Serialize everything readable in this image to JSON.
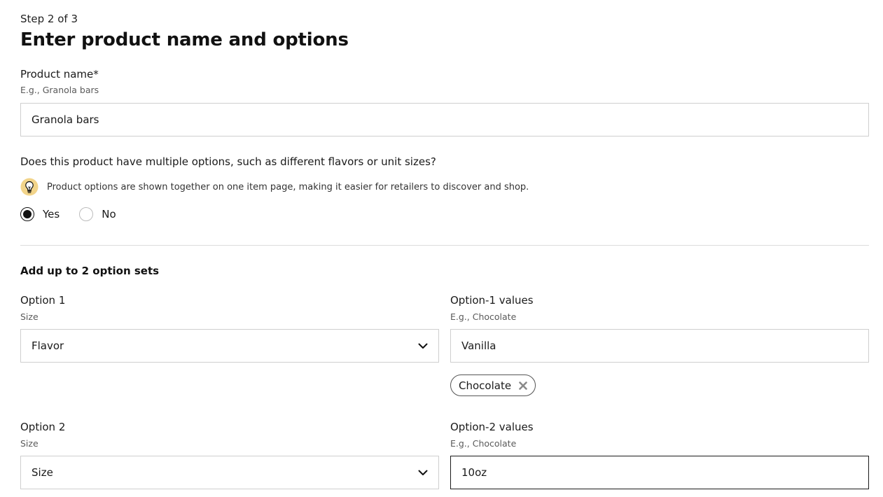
{
  "header": {
    "step": "Step 2 of 3",
    "title": "Enter product name and options"
  },
  "product_name": {
    "label": "Product name*",
    "hint": "E.g., Granola bars",
    "value": "Granola bars"
  },
  "multiple_options": {
    "question": "Does this product have multiple options, such as different flavors or unit sizes?",
    "tip_icon": "lightbulb-icon",
    "tip": "Product options are shown together on one item page, making it easier for retailers to discover and shop.",
    "choices": [
      {
        "label": "Yes",
        "selected": true
      },
      {
        "label": "No",
        "selected": false
      }
    ]
  },
  "option_sets": {
    "title": "Add up to 2 option sets",
    "option1": {
      "label": "Option 1",
      "hint": "Size",
      "selected": "Flavor",
      "values_label": "Option-1 values",
      "values_hint": "E.g., Chocolate",
      "values_input": "Vanilla",
      "chips": [
        "Chocolate"
      ]
    },
    "option2": {
      "label": "Option 2",
      "hint": "Size",
      "selected": "Size",
      "values_label": "Option-2 values",
      "values_hint": "E.g., Chocolate",
      "values_input": "10oz"
    }
  },
  "colors": {
    "text": "#1a1a1a",
    "border": "#cfcfcf",
    "focus_border": "#1a1a1a",
    "bulb": "#f2d48a"
  }
}
